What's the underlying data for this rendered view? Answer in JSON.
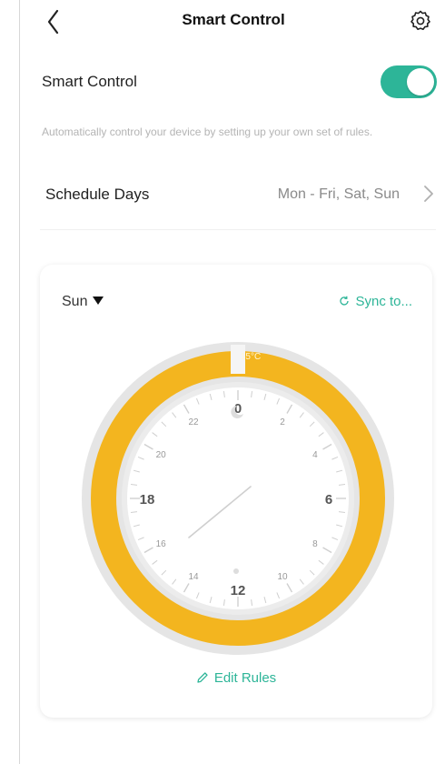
{
  "header": {
    "title": "Smart Control",
    "back_icon": "chevron-left-icon",
    "settings_icon": "gear-icon"
  },
  "smart_control": {
    "label": "Smart Control",
    "enabled": true
  },
  "description": "Automatically control your device by setting up your own set of rules.",
  "schedule": {
    "label": "Schedule Days",
    "value": "Mon - Fri, Sat, Sun"
  },
  "card": {
    "day": "Sun",
    "sync_label": "Sync to...",
    "edit_label": "Edit Rules",
    "temp_label": "15°C",
    "hour_labels": [
      "0",
      "2",
      "4",
      "6",
      "8",
      "10",
      "12",
      "14",
      "16",
      "18",
      "20",
      "22"
    ]
  },
  "colors": {
    "accent": "#2db598",
    "ring": "#f3b51f",
    "track": "#e5e5e5",
    "text_muted": "#b4b4b4"
  }
}
